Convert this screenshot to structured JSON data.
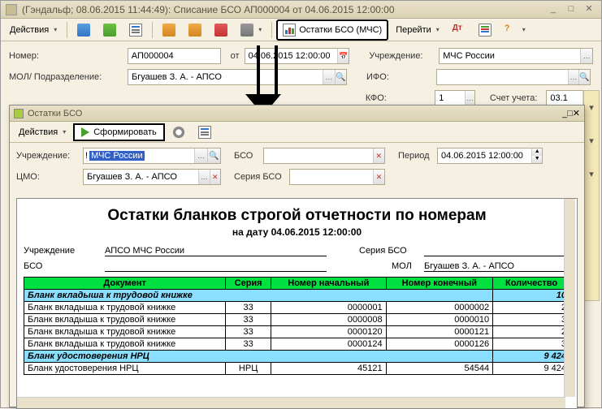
{
  "main_window": {
    "title": "(Гэндальф; 08.06.2015 11:44:49): Списание БСО АП000004 от 04.06.2015 12:00:00",
    "toolbar": {
      "actions_label": "Действия",
      "ostatki_label": "Остатки БСО (МЧС)",
      "goto_label": "Перейти"
    },
    "form": {
      "number_label": "Номер:",
      "number_value": "АП000004",
      "from_label": "от",
      "date_value": "04.06.2015 12:00:00",
      "org_label": "Учреждение:",
      "org_value": "МЧС России",
      "mol_label": "МОЛ/ Подразделение:",
      "mol_value": "Бгуашев З. А. - АПСО",
      "ifo_label": "ИФО:",
      "ifo_value": "",
      "kfo_label": "КФО:",
      "kfo_value": "1",
      "account_label": "Счет учета:",
      "account_value": "03.1"
    }
  },
  "inner_window": {
    "title": "Остатки БСО",
    "toolbar": {
      "actions_label": "Действия",
      "form_label": "Сформировать"
    },
    "form": {
      "org_label": "Учреждение:",
      "org_value": "МЧС России",
      "bso_label": "БСО",
      "bso_value": "",
      "period_label": "Период",
      "period_value": "04.06.2015 12:00:00",
      "cmo_label": "ЦМО:",
      "cmo_value": "Бгуашев З. А. - АПСО",
      "series_label": "Серия БСО",
      "series_value": ""
    }
  },
  "report": {
    "title": "Остатки бланков строгой отчетности по номерам",
    "subtitle": "на дату 04.06.2015 12:00:00",
    "meta": {
      "org_label": "Учреждение",
      "org_value": "АПСО МЧС России",
      "series_label": "Серия БСО",
      "series_value": "",
      "bso_label": "БСО",
      "bso_value": "",
      "mol_label": "МОЛ",
      "mol_value": "Бгуашев З. А. - АПСО"
    },
    "headers": [
      "Документ",
      "Серия",
      "Номер начальный",
      "Номер конечный",
      "Количество"
    ],
    "groups": [
      {
        "name": "Бланк вкладыша к трудовой книжке",
        "total": "10",
        "rows": [
          [
            "Бланк вкладыша к трудовой книжке",
            "33",
            "0000001",
            "0000002",
            "2"
          ],
          [
            "Бланк вкладыша к трудовой книжке",
            "33",
            "0000008",
            "0000010",
            "3"
          ],
          [
            "Бланк вкладыша к трудовой книжке",
            "33",
            "0000120",
            "0000121",
            "2"
          ],
          [
            "Бланк вкладыша к трудовой книжке",
            "33",
            "0000124",
            "0000126",
            "3"
          ]
        ]
      },
      {
        "name": "Бланк удостоверения НРЦ",
        "total": "9 424",
        "rows": [
          [
            "Бланк удостоверения НРЦ",
            "НРЦ",
            "45121",
            "54544",
            "9 424"
          ]
        ]
      }
    ]
  }
}
